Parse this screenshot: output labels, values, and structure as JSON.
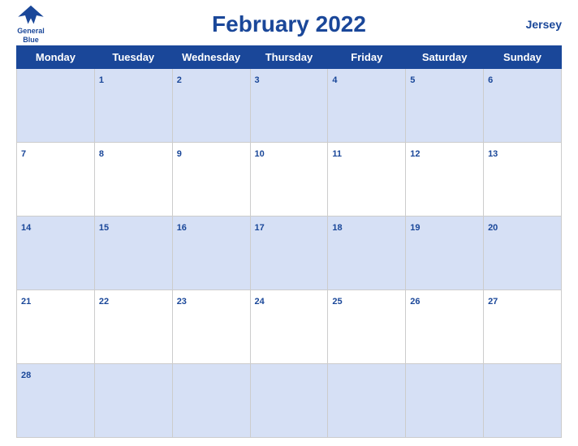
{
  "header": {
    "title": "February 2022",
    "region": "Jersey",
    "logo_line1": "General",
    "logo_line2": "Blue"
  },
  "weekdays": [
    "Monday",
    "Tuesday",
    "Wednesday",
    "Thursday",
    "Friday",
    "Saturday",
    "Sunday"
  ],
  "weeks": [
    [
      null,
      1,
      2,
      3,
      4,
      5,
      6
    ],
    [
      7,
      8,
      9,
      10,
      11,
      12,
      13
    ],
    [
      14,
      15,
      16,
      17,
      18,
      19,
      20
    ],
    [
      21,
      22,
      23,
      24,
      25,
      26,
      27
    ],
    [
      28,
      null,
      null,
      null,
      null,
      null,
      null
    ]
  ],
  "colors": {
    "primary": "#1a4799",
    "row_alt": "#d6e0f5"
  }
}
